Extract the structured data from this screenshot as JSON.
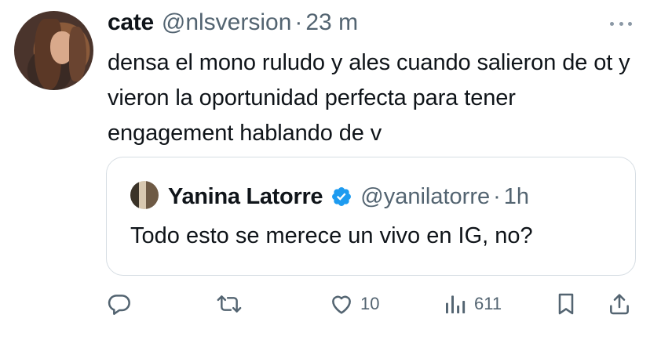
{
  "tweet": {
    "author_name": "cate",
    "author_handle": "@nlsversion",
    "separator": "·",
    "timestamp": "23 m",
    "text": "densa el mono ruludo y ales cuando salieron de ot y vieron la oportunidad perfecta para tener engagement hablando de v"
  },
  "quote": {
    "author_name": "Yanina Latorre",
    "author_handle": "@yanilatorre",
    "separator": "·",
    "timestamp": "1h",
    "verified": true,
    "text": "Todo esto se merece un vivo en IG, no?"
  },
  "actions": {
    "reply_count": "",
    "retweet_count": "",
    "like_count": "10",
    "views_count": "611"
  },
  "icons": {
    "more": "more-dots-icon",
    "reply": "reply-icon",
    "retweet": "retweet-icon",
    "like": "heart-icon",
    "views": "views-icon",
    "bookmark": "bookmark-icon",
    "share": "share-icon",
    "verified": "verified-badge-icon"
  },
  "colors": {
    "text": "#0f1419",
    "muted": "#536471",
    "verified": "#1d9bf0",
    "border": "#d6dde3"
  }
}
